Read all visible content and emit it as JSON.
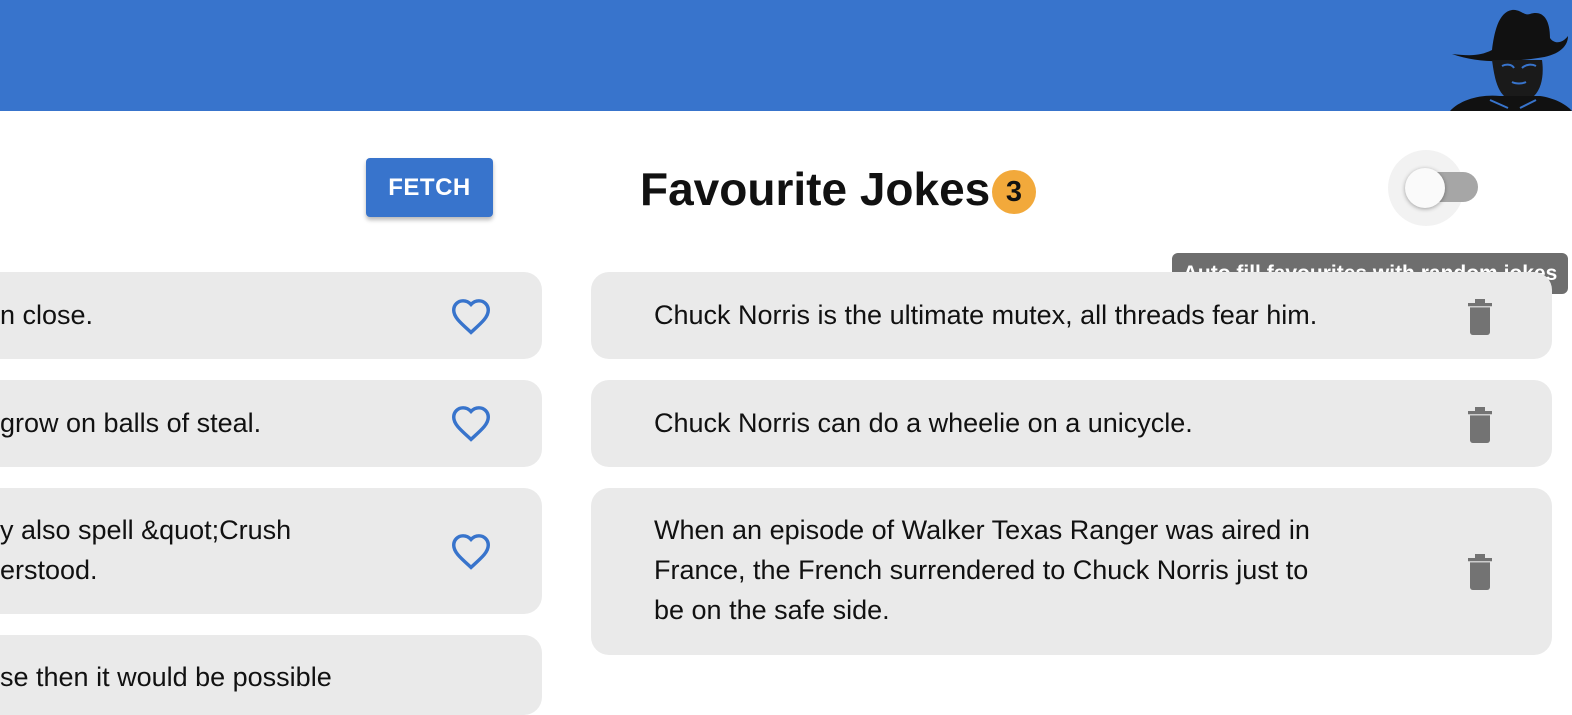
{
  "header": {
    "avatar_icon": "chuck-norris-avatar-icon",
    "color": "#3874cc"
  },
  "random_jokes": {
    "fetch_label": "FETCH",
    "items": [
      {
        "text": "n close.",
        "icon": "heart-outline-icon"
      },
      {
        "text": "grow on balls of steal.",
        "icon": "heart-outline-icon"
      },
      {
        "text": "y also spell &quot;Crush\nerstood.",
        "icon": "heart-outline-icon"
      },
      {
        "text": "se then it would be possible",
        "icon": "heart-outline-icon"
      }
    ]
  },
  "favourites": {
    "title": "Favourite Jokes",
    "count": "3",
    "badge_color": "#f2a93b",
    "auto_fill_toggle": {
      "on": false
    },
    "tooltip": "Auto fill favourites with random jokes",
    "items": [
      {
        "text": "Chuck Norris is the ultimate mutex, all threads fear him.",
        "icon": "trash-icon"
      },
      {
        "text": "Chuck Norris can do a wheelie on a unicycle.",
        "icon": "trash-icon"
      },
      {
        "text": "When an episode of Walker Texas Ranger was aired in\nFrance, the French surrendered to Chuck Norris just to\nbe on the safe side.",
        "icon": "trash-icon"
      }
    ]
  }
}
